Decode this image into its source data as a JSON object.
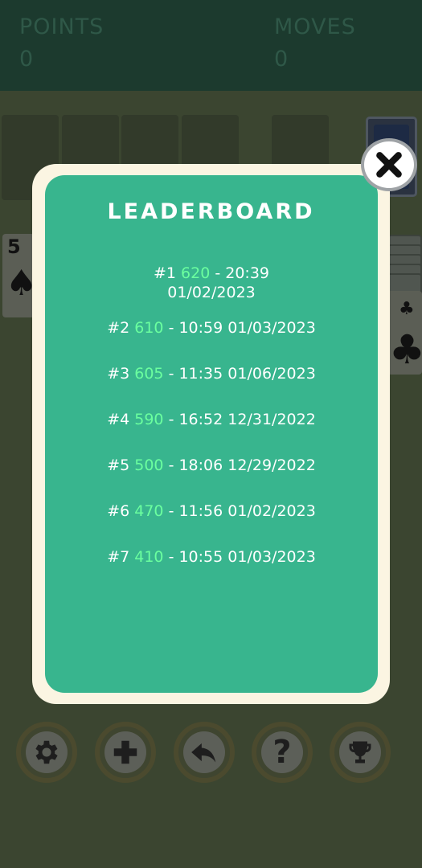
{
  "header": {
    "points_label": "POINTS",
    "points_value": "0",
    "moves_label": "MOVES",
    "moves_value": "0"
  },
  "board": {
    "left_card_rank": "5",
    "left_card_suit": "♠",
    "right_card_suit_small": "♣",
    "right_card_suit_big": "♣"
  },
  "leaderboard": {
    "title": "LEADERBOARD",
    "entries": [
      {
        "rank": "#1",
        "score": "620",
        "time": "20:39",
        "date": "01/02/2023"
      },
      {
        "rank": "#2",
        "score": "610",
        "time": "10:59",
        "date": "01/03/2023"
      },
      {
        "rank": "#3",
        "score": "605",
        "time": "11:35",
        "date": "01/06/2023"
      },
      {
        "rank": "#4",
        "score": "590",
        "time": "16:52",
        "date": "12/31/2022"
      },
      {
        "rank": "#5",
        "score": "500",
        "time": "18:06",
        "date": "12/29/2022"
      },
      {
        "rank": "#6",
        "score": "470",
        "time": "11:56",
        "date": "01/02/2023"
      },
      {
        "rank": "#7",
        "score": "410",
        "time": "10:55",
        "date": "01/03/2023"
      }
    ],
    "separator": "-"
  },
  "toolbar": {
    "icons": [
      "gear-icon",
      "plus-icon",
      "undo-icon",
      "help-icon",
      "trophy-icon"
    ],
    "plus_glyph": "✚",
    "help_glyph": "?"
  },
  "colors": {
    "modal_bg": "#38b58e",
    "modal_border": "#fbf5e2",
    "score_highlight": "#6bff9f",
    "header_bg": "#1c3a2e"
  }
}
